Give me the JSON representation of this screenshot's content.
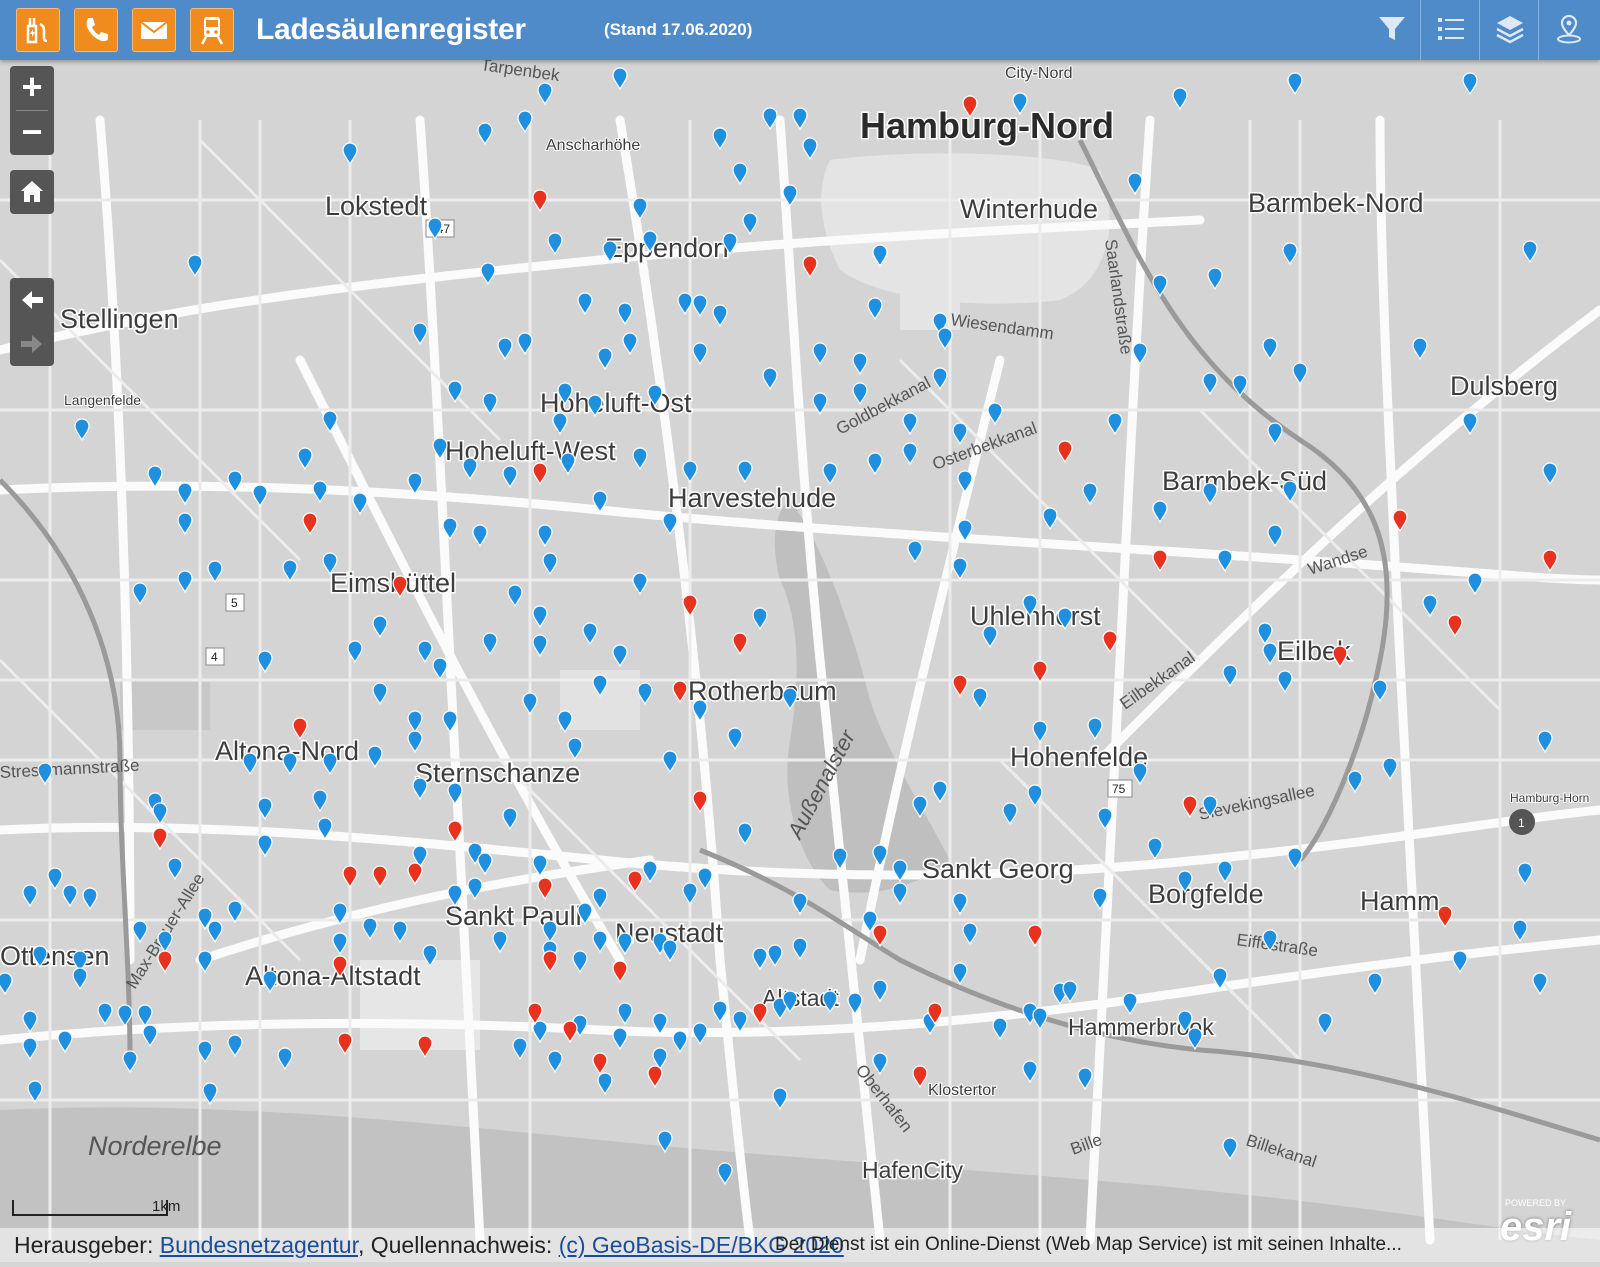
{
  "header": {
    "title": "Ladesäulenregister",
    "stand": "(Stand 17.06.2020)",
    "left_icons": [
      "charging-station-icon",
      "phone-icon",
      "mail-icon",
      "train-icon"
    ],
    "right_icons": [
      "filter-icon",
      "list-icon",
      "layers-icon",
      "locate-icon"
    ],
    "bar_color": "#4f8ac9",
    "icon_color": "#f08c1e"
  },
  "map": {
    "controls": {
      "zoom_in": "+",
      "zoom_out": "−"
    },
    "labels": {
      "large": [
        "Hamburg-Nord"
      ],
      "districts": [
        "Lokstedt",
        "Eppendorf",
        "Winterhude",
        "Barmbek-Nord",
        "Stellingen",
        "Hoheluft-Ost",
        "Hoheluft-West",
        "Dulsberg",
        "Harvestehude",
        "Barmbek-Süd",
        "Eimsbüttel",
        "Uhlenhorst",
        "Eilbek",
        "Rotherbaum",
        "Altona-Nord",
        "Sternschanze",
        "Hohenfelde",
        "Sankt Georg",
        "Borgfelde",
        "Hamm",
        "Sankt Pauli",
        "Neustadt",
        "Ottensen",
        "Altona-Altstadt",
        "Altstadt",
        "Hammerbrook",
        "HafenCity"
      ],
      "water": [
        "Norderelbe",
        "Außenalster"
      ],
      "small": [
        "City-Nord",
        "Anscharhöhe",
        "Langenfelde",
        "Klostertor",
        "Hamburg-Horn"
      ],
      "streets": [
        "Tarpenbek",
        "Wiesendamm",
        "Saarlandstraße",
        "Goldbekkanal",
        "Osterbekkanal",
        "Eilbekkanal",
        "Sievekingsallee",
        "Eiffestraße",
        "Wandse",
        "Oberhafen",
        "Bille",
        "Billekanal",
        "Max-Brauer-Allee",
        "Stresemannstraße"
      ],
      "road_numbers": [
        "447",
        "5",
        "4",
        "75",
        "1"
      ]
    },
    "charging_point_colors": {
      "normal": "#1f8fe0",
      "fast": "#e8321e"
    }
  },
  "scale": {
    "label": "1km"
  },
  "attribution": {
    "prefix": "Herausgeber: ",
    "publisher": "Bundesnetzagentur",
    "middle": ", Quellennachweis: ",
    "source": "(c) GeoBasis-DE/BKG 2020",
    "overlay": "Der Dienst ist ein Online-Dienst (Web Map Service) ist mit seinen Inhalte...",
    "logo": "esri",
    "powered": "POWERED BY"
  }
}
